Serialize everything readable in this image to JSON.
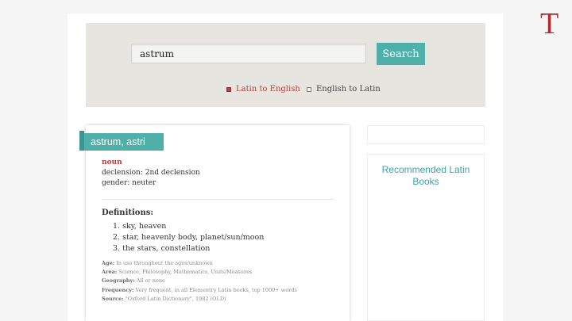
{
  "brand": {
    "logo_letter": "T"
  },
  "search": {
    "query": "astrum",
    "button_label": "Search",
    "options": [
      {
        "label": "Latin to English",
        "selected": true
      },
      {
        "label": "English to Latin",
        "selected": false
      }
    ]
  },
  "entry": {
    "headword": "astrum, astri",
    "part_of_speech": "noun",
    "declension": "declension: 2nd declension",
    "gender": "gender: neuter",
    "definitions_heading": "Definitions:",
    "definitions": [
      "1. sky, heaven",
      "2. star, heavenly body, planet/sun/moon",
      "3. the stars, constellation"
    ],
    "meta": [
      {
        "label": "Age:",
        "value": "In use throughout the ages/unknown"
      },
      {
        "label": "Area:",
        "value": "Science, Philosophy, Mathematics, Units/Measures"
      },
      {
        "label": "Geography:",
        "value": "All or none"
      },
      {
        "label": "Frequency:",
        "value": "Very frequent, in all Elementry Latin books, top 1000+ words"
      },
      {
        "label": "Source:",
        "value": "\"Oxford Latin Dictionary\", 1982 (OLD)"
      }
    ]
  },
  "sidebar": {
    "books_title": "Recommended Latin Books"
  },
  "colors": {
    "accent": "#4fb0aa",
    "brand_red": "#b52a2a",
    "pos_red": "#c23a3a",
    "link_teal": "#3aa3ac"
  }
}
